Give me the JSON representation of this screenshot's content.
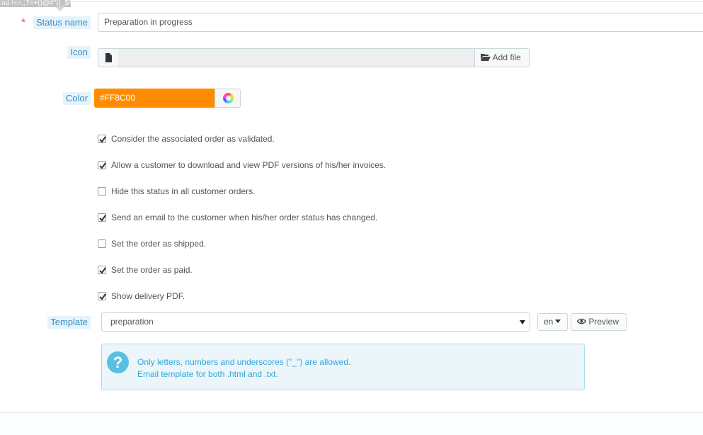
{
  "tooltip": {
    "text": "nd !<>,;?=+()@#\"{}_$%:"
  },
  "form": {
    "status_name": {
      "label": "Status name",
      "required_mark": "*",
      "value": "Preparation in progress"
    },
    "icon": {
      "label": "Icon",
      "button_label": "Add file",
      "file_icon": "file-icon",
      "button_icon": "folder-open-icon"
    },
    "color": {
      "label": "Color",
      "value": "#FF8C00",
      "swatch_color": "#FF8C00",
      "picker_icon": "color-wheel-icon"
    },
    "checkboxes": [
      {
        "label": "Consider the associated order as validated.",
        "checked": true
      },
      {
        "label": "Allow a customer to download and view PDF versions of his/her invoices.",
        "checked": true
      },
      {
        "label": "Hide this status in all customer orders.",
        "checked": false
      },
      {
        "label": "Send an email to the customer when his/her order status has changed.",
        "checked": true
      },
      {
        "label": "Set the order as shipped.",
        "checked": false
      },
      {
        "label": "Set the order as paid.",
        "checked": true
      },
      {
        "label": "Show delivery PDF.",
        "checked": true
      }
    ],
    "template": {
      "label": "Template",
      "selected": "preparation",
      "lang": "en",
      "preview_label": "Preview",
      "preview_icon": "eye-icon"
    },
    "help": {
      "icon": "question-icon",
      "glyph": "?",
      "line1": "Only letters, numbers and underscores (\"_\") are allowed.",
      "line2": "Email template for both .html and .txt."
    }
  },
  "colors": {
    "label_text": "#3a8cc3",
    "label_bg": "#e6f3fb",
    "accent": "#FF8C00",
    "help_text": "#2fa6d6",
    "required": "#e74c3c"
  }
}
